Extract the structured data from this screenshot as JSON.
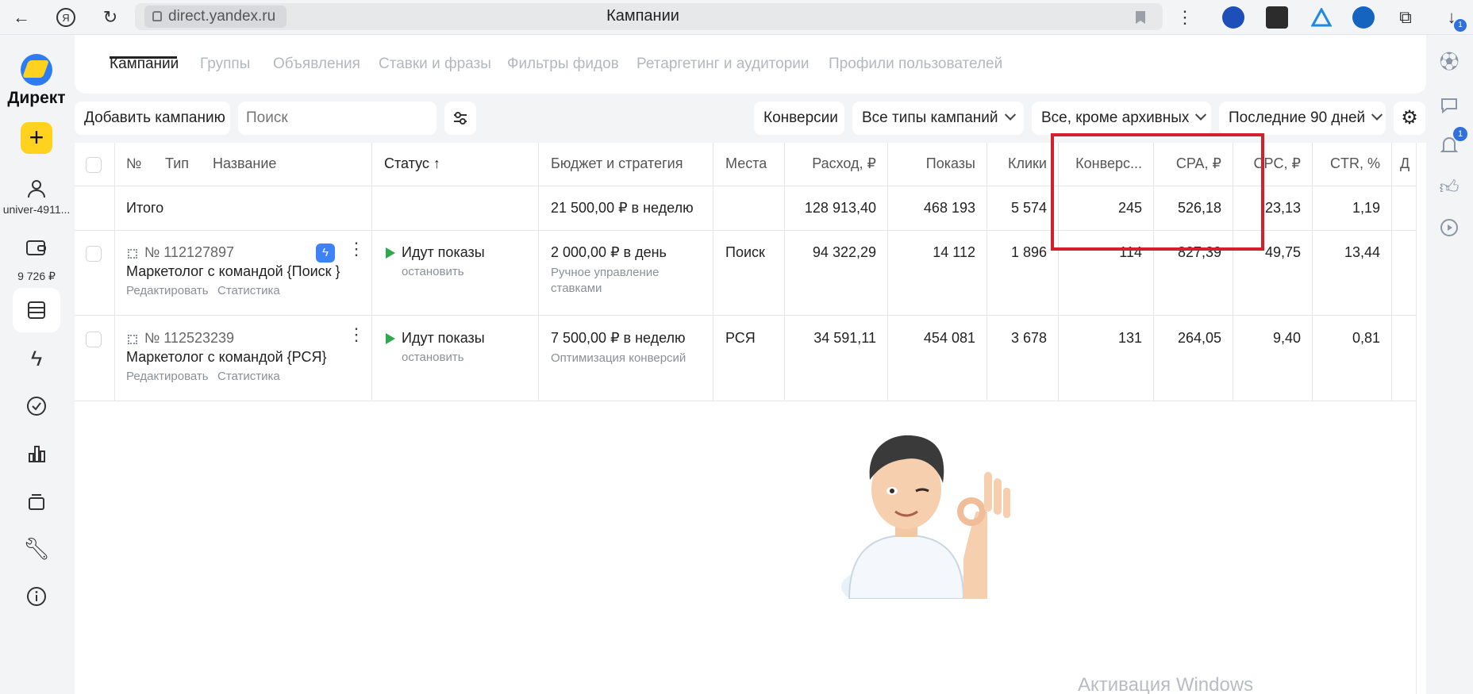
{
  "browser": {
    "url": "direct.yandex.ru",
    "page_title": "Кампании",
    "download_badge": "1"
  },
  "sidebar": {
    "brand": "Директ",
    "plus": "+",
    "user_name": "univer-4911...",
    "balance": "9 726 ₽"
  },
  "rightbar": {
    "notifications_badge": "1"
  },
  "tabs": [
    {
      "label": "Кампании",
      "active": true
    },
    {
      "label": "Группы"
    },
    {
      "label": "Объявления"
    },
    {
      "label": "Ставки и фразы"
    },
    {
      "label": "Фильтры фидов"
    },
    {
      "label": "Ретаргетинг и аудитории"
    },
    {
      "label": "Профили пользователей"
    }
  ],
  "toolbar": {
    "add_campaign": "Добавить кампанию",
    "search_placeholder": "Поиск",
    "conversions": "Конверсии",
    "campaign_types": "Все типы кампаний",
    "archive_filter": "Все, кроме архивных",
    "period": "Последние 90 дней"
  },
  "table": {
    "headers": {
      "number": "№",
      "type": "Тип",
      "name": "Название",
      "status": "Статус ↑",
      "budget": "Бюджет и стратегия",
      "places": "Места",
      "spend": "Расход, ₽",
      "impressions": "Показы",
      "clicks": "Клики",
      "conversions": "Конверс...",
      "cpa": "CPA, ₽",
      "cpc": "CPC, ₽",
      "ctr": "CTR, %",
      "extra": "Д"
    },
    "total": {
      "label": "Итого",
      "budget": "21 500,00 ₽ в неделю",
      "spend": "128 913,40",
      "impressions": "468 193",
      "clicks": "5 574",
      "conversions": "245",
      "cpa": "526,18",
      "cpc": "23,13",
      "ctr": "1,19"
    },
    "rows": [
      {
        "id": "№ 112127897",
        "name": "Маркетолог с командой {Поиск }",
        "edit": "Редактировать",
        "stats": "Статистика",
        "status": "Идут показы",
        "status_action": "остановить",
        "budget": "2 000,00 ₽ в день",
        "strategy_line1": "Ручное управление",
        "strategy_line2": "ставками",
        "places": "Поиск",
        "spend": "94 322,29",
        "impressions": "14 112",
        "clicks": "1 896",
        "conversions": "114",
        "cpa": "827,39",
        "cpc": "49,75",
        "ctr": "13,44"
      },
      {
        "id": "№ 112523239",
        "name": "Маркетолог с командой {РСЯ}",
        "edit": "Редактировать",
        "stats": "Статистика",
        "status": "Идут показы",
        "status_action": "остановить",
        "budget": "7 500,00 ₽ в неделю",
        "strategy_line1": "Оптимизация конверсий",
        "places": "РСЯ",
        "spend": "34 591,11",
        "impressions": "454 081",
        "clicks": "3 678",
        "conversions": "131",
        "cpa": "264,05",
        "cpc": "9,40",
        "ctr": "0,81"
      }
    ]
  },
  "overlay": {
    "watermark": "Активация Windows"
  },
  "colors": {
    "accent_yellow": "#ffd21f",
    "highlight_red": "#d4202a",
    "status_green": "#2fa84f",
    "brand_blue": "#2d7cf6"
  }
}
